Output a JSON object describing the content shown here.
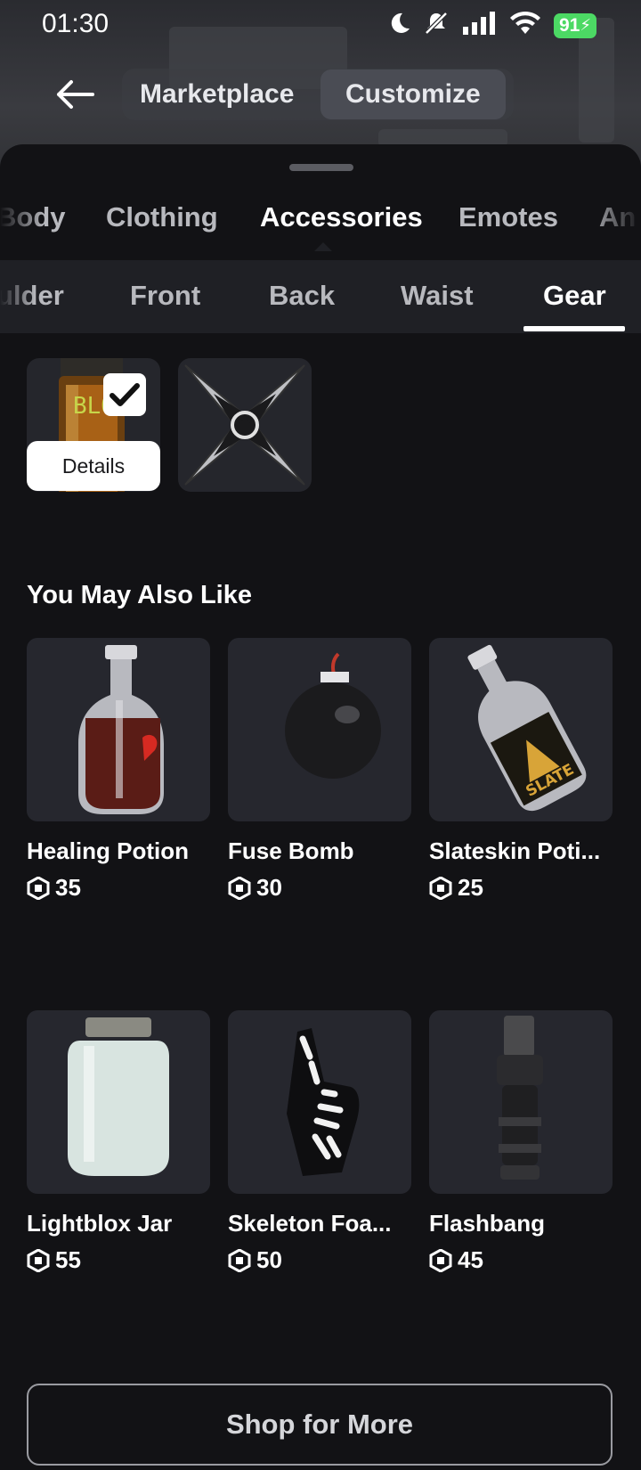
{
  "status": {
    "time": "01:30",
    "battery": "91",
    "icons": [
      "moon-icon",
      "bell-muted-icon",
      "signal-icon",
      "wifi-icon",
      "battery-charging-icon"
    ]
  },
  "header": {
    "back_icon": "arrow-left-icon",
    "tabs": [
      {
        "label": "Marketplace",
        "active": false
      },
      {
        "label": "Customize",
        "active": true
      }
    ]
  },
  "categories": [
    {
      "label": "Body",
      "active": false
    },
    {
      "label": "Clothing",
      "active": false
    },
    {
      "label": "Accessories",
      "active": true
    },
    {
      "label": "Emotes",
      "active": false
    },
    {
      "label": "An",
      "active": false
    }
  ],
  "subcategories": [
    {
      "label": "ulder",
      "active": false
    },
    {
      "label": "Front",
      "active": false
    },
    {
      "label": "Back",
      "active": false
    },
    {
      "label": "Waist",
      "active": false
    },
    {
      "label": "Gear",
      "active": true
    }
  ],
  "owned": {
    "details_label": "Details",
    "items": [
      {
        "icon": "blox-jar-icon",
        "equipped": true,
        "thumb_text": "BLO"
      },
      {
        "icon": "shuriken-icon",
        "equipped": false
      }
    ]
  },
  "recommendations": {
    "title": "You May Also Like",
    "currency_icon": "robux-icon",
    "items": [
      {
        "name": "Healing Potion",
        "price": "35",
        "icon": "healing-potion-icon"
      },
      {
        "name": "Fuse Bomb",
        "price": "30",
        "icon": "fuse-bomb-icon"
      },
      {
        "name": "Slateskin Poti...",
        "price": "25",
        "icon": "slateskin-potion-icon",
        "label_text": "SLATE"
      },
      {
        "name": "Lightblox Jar",
        "price": "55",
        "icon": "lightblox-jar-icon"
      },
      {
        "name": "Skeleton Foa...",
        "price": "50",
        "icon": "skeleton-foam-finger-icon"
      },
      {
        "name": "Flashbang",
        "price": "45",
        "icon": "flashbang-icon"
      }
    ]
  },
  "footer": {
    "shop_label": "Shop for More"
  },
  "colors": {
    "background": "#121215",
    "card": "#26272e",
    "tab_bar": "#1f2025",
    "battery": "#4cd964"
  }
}
